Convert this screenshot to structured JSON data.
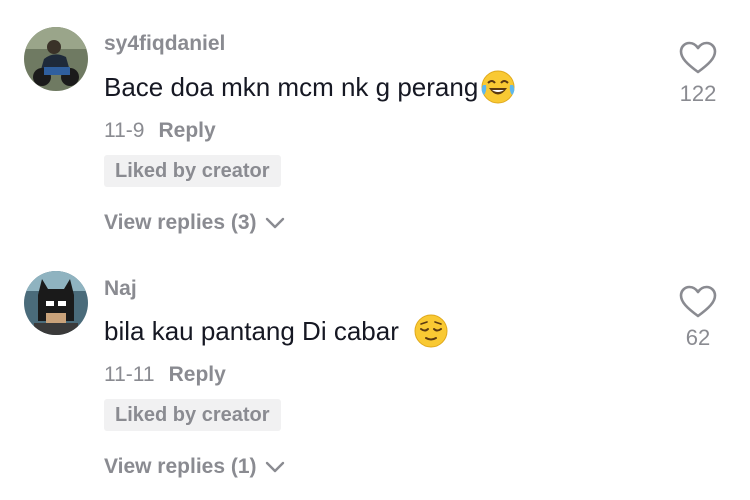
{
  "comments": [
    {
      "username": "sy4fiqdaniel",
      "text": "Bace doa mkn mcm nk g perang",
      "emoji": "face-with-tears-of-joy",
      "date": "11-9",
      "reply_label": "Reply",
      "badge": "Liked by creator",
      "view_replies": "View replies (3)",
      "like_count": "122",
      "avatar_icon": "user-avatar-motorbike"
    },
    {
      "username": "Naj",
      "text": "bila kau pantang Di cabar",
      "emoji": "relieved-face",
      "date": "11-11",
      "reply_label": "Reply",
      "badge": "Liked by creator",
      "view_replies": "View replies (1)",
      "like_count": "62",
      "avatar_icon": "user-avatar-masked"
    }
  ],
  "colors": {
    "primary_text": "#161823",
    "secondary_text": "#8a8b91",
    "badge_bg": "#f1f1f2"
  }
}
